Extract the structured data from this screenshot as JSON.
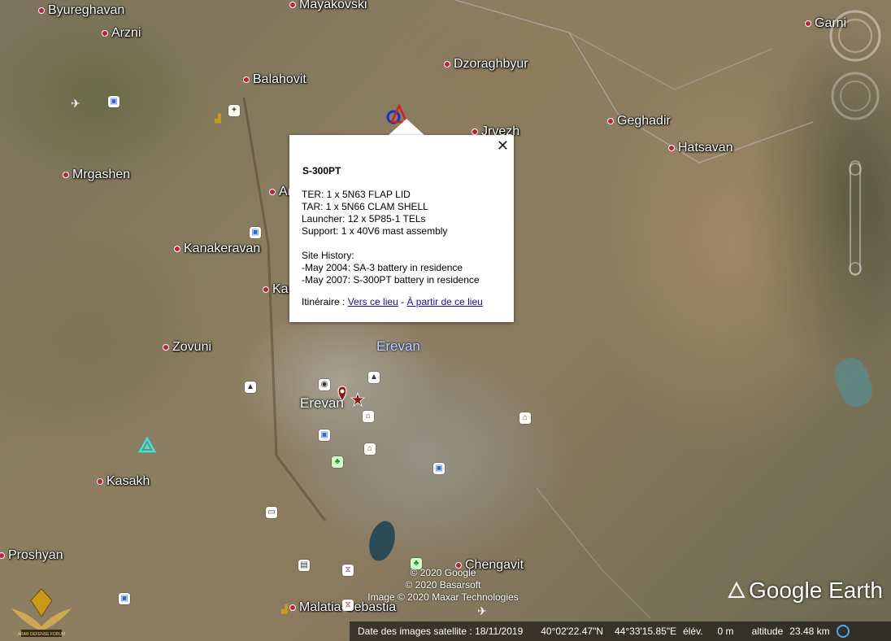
{
  "map": {
    "places": [
      {
        "id": "byureghavan",
        "name": "Byureghavan"
      },
      {
        "id": "arzni",
        "name": "Arzni"
      },
      {
        "id": "mayakovski",
        "name": "Mayakovski"
      },
      {
        "id": "balahovit",
        "name": "Balahovit"
      },
      {
        "id": "dzoraghbyur",
        "name": "Dzoraghbyur"
      },
      {
        "id": "jrvezh",
        "name": "Jrvezh"
      },
      {
        "id": "geghadir",
        "name": "Geghadir"
      },
      {
        "id": "hatsavan",
        "name": "Hatsavan"
      },
      {
        "id": "garni",
        "name": "Garni"
      },
      {
        "id": "mrgashen",
        "name": "Mrgashen"
      },
      {
        "id": "ar",
        "name": "Ar"
      },
      {
        "id": "kanakeravan",
        "name": "Kanakeravan"
      },
      {
        "id": "kar",
        "name": "Kar"
      },
      {
        "id": "zovuni",
        "name": "Zovuni"
      },
      {
        "id": "kasakh",
        "name": "Kasakh"
      },
      {
        "id": "proshyan",
        "name": "Proshyan"
      },
      {
        "id": "chengavit",
        "name": "Chengavit"
      },
      {
        "id": "malatia",
        "name": "Malatia-Sebastia"
      }
    ],
    "city": "Erevan",
    "district": "Erevan"
  },
  "popup": {
    "title": "S-300PT",
    "lines": [
      "TER: 1 x 5N63 FLAP LID",
      "TAR: 1 x 5N66 CLAM SHELL",
      "Launcher: 12 x 5P85-1 TELs",
      "Support: 1 x 40V6 mast assembly",
      "",
      "Site History:",
      "-May 2004: SA-3 battery in residence",
      "-May 2007: S-300PT battery in residence"
    ],
    "route_label": "Itinéraire :",
    "route_to": "Vers ce lieu",
    "route_sep": "-",
    "route_from": "À partir de ce lieu",
    "close": "✕"
  },
  "copyright": [
    "© 2020 Google",
    "© 2020 Basarsoft",
    "Image © 2020 Maxar Technologies"
  ],
  "logo": "Google Earth",
  "status": {
    "imagery_date": "Date des images satellite : 18/11/2019",
    "lat": "40°02'22.47\"N",
    "lon": "44°33'15.85\"E",
    "elev_label": "élév.",
    "elev": "0 m",
    "alt_label": "altitude",
    "alt": "23.48 km"
  },
  "forum_logo_text": "ARAB DEFENSE FORUM"
}
